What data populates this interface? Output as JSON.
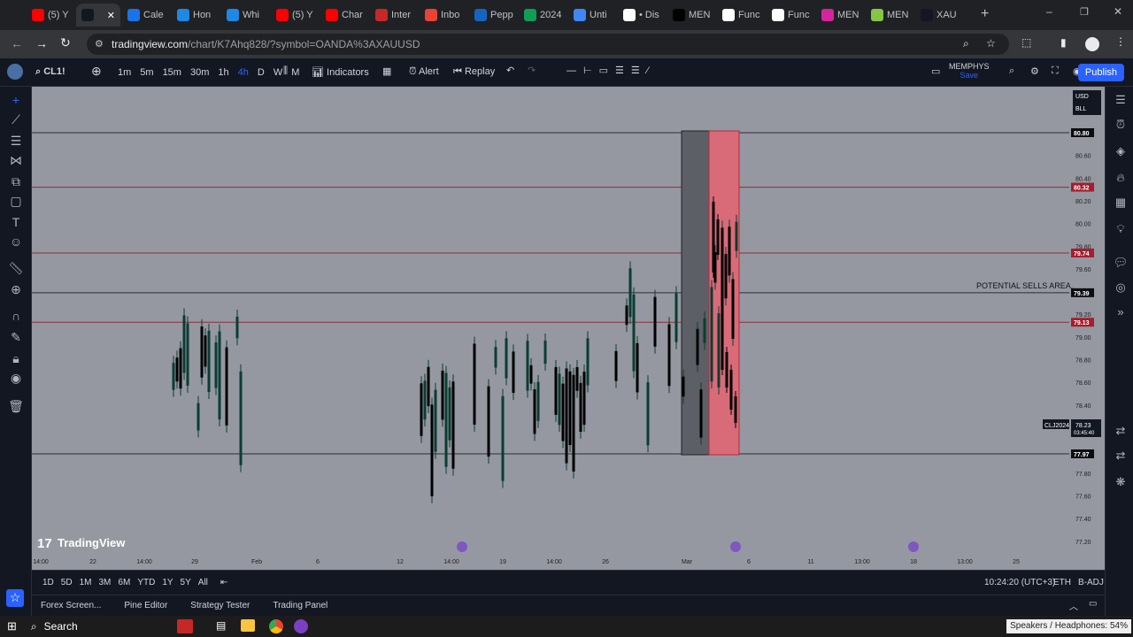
{
  "browser": {
    "tabs": [
      {
        "label": "(5) Y",
        "icon": "youtube-icon",
        "color": "#ff0000"
      },
      {
        "label": "",
        "icon": "tradingview-icon",
        "color": "#131722",
        "active": true
      },
      {
        "label": "Cale",
        "icon": "calendar-icon",
        "color": "#1a73e8"
      },
      {
        "label": "Hon",
        "icon": "c-icon",
        "color": "#1e88e5"
      },
      {
        "label": "Whi",
        "icon": "c-icon",
        "color": "#1e88e5"
      },
      {
        "label": "(5) Y",
        "icon": "youtube-icon",
        "color": "#ff0000"
      },
      {
        "label": "Char",
        "icon": "youtube-icon",
        "color": "#ff0000"
      },
      {
        "label": "Inter",
        "icon": "gauge-icon",
        "color": "#c62828"
      },
      {
        "label": "Inbo",
        "icon": "gmail-icon",
        "color": "#ea4335"
      },
      {
        "label": "Pepp",
        "icon": "pepperstone-icon",
        "color": "#1565c0"
      },
      {
        "label": "2024",
        "icon": "sheets-icon",
        "color": "#0f9d58"
      },
      {
        "label": "Unti",
        "icon": "docs-icon",
        "color": "#4285f4"
      },
      {
        "label": "• Dis",
        "icon": "google-icon",
        "color": "#ffffff"
      },
      {
        "label": "MEN",
        "icon": "x-icon",
        "color": "#000000"
      },
      {
        "label": "Func",
        "icon": "notion-icon",
        "color": "#ffffff"
      },
      {
        "label": "Func",
        "icon": "notion-icon",
        "color": "#ffffff"
      },
      {
        "label": "MEN",
        "icon": "instagram-icon",
        "color": "#d6249f"
      },
      {
        "label": "MEN",
        "icon": "rumble-icon",
        "color": "#85c742"
      },
      {
        "label": "XAU",
        "icon": "tradingview-icon",
        "color": "#131722"
      }
    ],
    "url_host": "tradingview.com",
    "url_path": "/chart/K7Ahq828/?symbol=OANDA%3AXAUUSD"
  },
  "toolbar": {
    "symbol": "CL1!",
    "intervals": [
      "1m",
      "5m",
      "15m",
      "30m",
      "1h",
      "4h",
      "D",
      "W",
      "M"
    ],
    "selected_interval": "4h",
    "indicators_label": "Indicators",
    "alert_label": "Alert",
    "replay_label": "Replay",
    "layout_name": "MEMPHYS",
    "layout_status": "Save",
    "publish_label": "Publish"
  },
  "chart": {
    "currency_label": "USD",
    "unit_label": "BLL",
    "price_ticks": [
      "80.60",
      "80.40",
      "80.20",
      "80.00",
      "79.80",
      "79.60",
      "79.20",
      "79.00",
      "78.80",
      "78.60",
      "78.40",
      "77.80",
      "77.60",
      "77.40",
      "77.20"
    ],
    "price_labels": [
      {
        "text": "80.80",
        "kind": "black"
      },
      {
        "text": "80.32",
        "kind": "red"
      },
      {
        "text": "79.74",
        "kind": "red"
      },
      {
        "text": "79.39",
        "kind": "black"
      },
      {
        "text": "79.13",
        "kind": "red"
      },
      {
        "text": "77.97",
        "kind": "black"
      }
    ],
    "symbol_tag": "CLJ2024",
    "last_price": "78.23",
    "countdown": "03:45:40",
    "annotation": "POTENTIAL SELLS AREA.",
    "time_ticks": [
      "14:00",
      "22",
      "14:00",
      "29",
      "Feb",
      "6",
      "12",
      "14:00",
      "19",
      "14:00",
      "26",
      "Mar",
      "6",
      "11",
      "13:00",
      "18",
      "13:00",
      "25"
    ],
    "watermark": "TradingView",
    "colors": {
      "background": "#9598a1",
      "candle": "#0a3d33",
      "red_zone": "#d96b79",
      "grey_zone": "#5d5f66"
    }
  },
  "range_bar": {
    "ranges": [
      "1D",
      "5D",
      "1M",
      "3M",
      "6M",
      "YTD",
      "1Y",
      "5Y",
      "All"
    ],
    "clock": "10:24:20 (UTC+3)",
    "session": "ETH",
    "adjust": "B-ADJ"
  },
  "panels": [
    "Forex Screen...",
    "Pine Editor",
    "Strategy Tester",
    "Trading Panel"
  ],
  "taskbar": {
    "search_label": "Search",
    "tray_text": "Speakers / Headphones: 54%"
  }
}
